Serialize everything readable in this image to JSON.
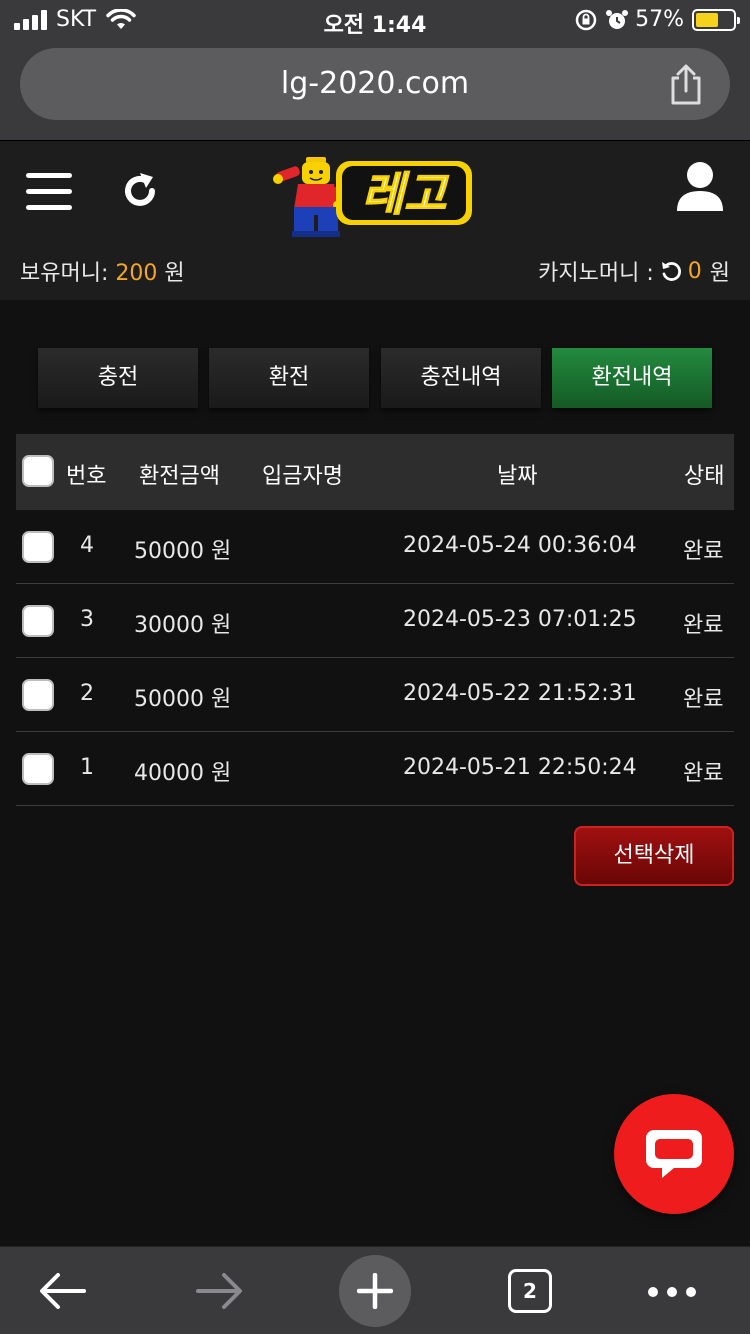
{
  "status_bar": {
    "carrier": "SKT",
    "time": "오전 1:44",
    "battery": "57%"
  },
  "browser": {
    "url": "lg-2020.com",
    "open_tab_count": "2"
  },
  "header": {
    "logo_text": "레고",
    "holding_money_label": "보유머니:",
    "holding_money_value": "200",
    "holding_money_unit": "원",
    "casino_money_label": "카지노머니 :",
    "casino_money_value": "0",
    "casino_money_unit": "원"
  },
  "tabs": [
    {
      "label": "충전",
      "active": false
    },
    {
      "label": "환전",
      "active": false
    },
    {
      "label": "충전내역",
      "active": false
    },
    {
      "label": "환전내역",
      "active": true
    }
  ],
  "table": {
    "columns": [
      "번호",
      "환전금액",
      "입금자명",
      "날짜",
      "상태"
    ],
    "rows": [
      {
        "no": "4",
        "amount": "50000 원",
        "name": "",
        "date": "2024-05-24 00:36:04",
        "status": "완료"
      },
      {
        "no": "3",
        "amount": "30000 원",
        "name": "",
        "date": "2024-05-23 07:01:25",
        "status": "완료"
      },
      {
        "no": "2",
        "amount": "50000 원",
        "name": "",
        "date": "2024-05-22 21:52:31",
        "status": "완료"
      },
      {
        "no": "1",
        "amount": "40000 원",
        "name": "",
        "date": "2024-05-21 22:50:24",
        "status": "완료"
      }
    ]
  },
  "actions": {
    "delete_selected": "선택삭제"
  },
  "colors": {
    "accent_orange": "#f5a623",
    "active_tab_green": "#1f7a35",
    "delete_red": "#8a0b0b",
    "chat_red": "#ee1c1c"
  }
}
